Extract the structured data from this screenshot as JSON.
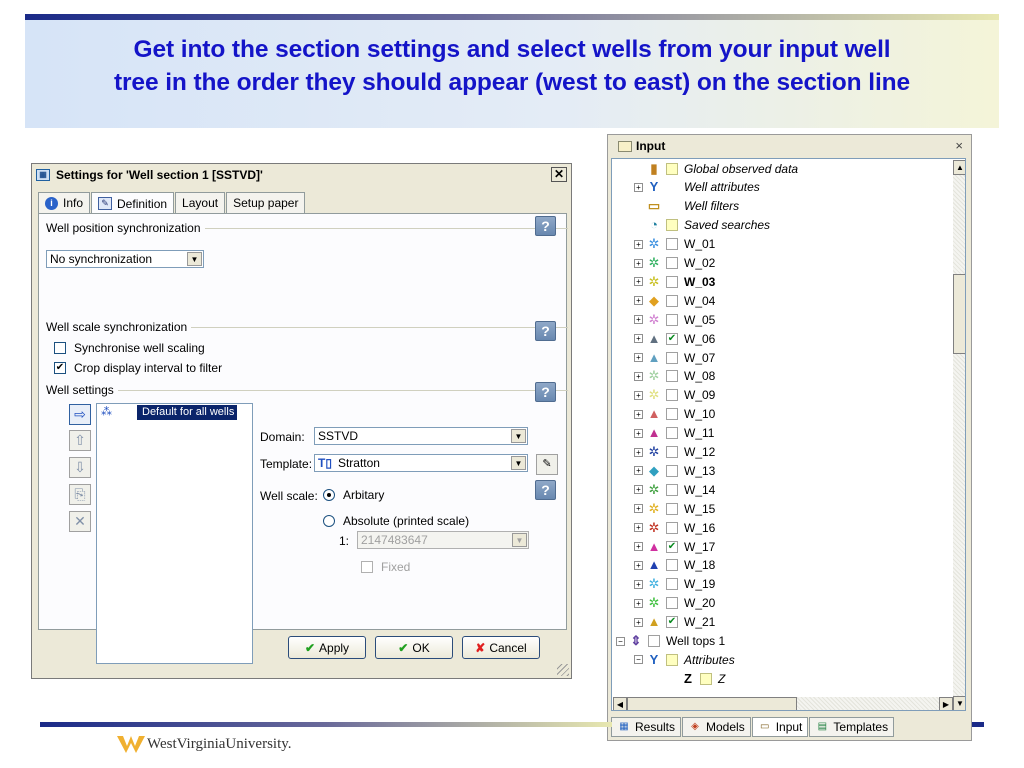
{
  "slide": {
    "title_line1": "Get into the section settings and select wells from your input well",
    "title_line2": "tree in the order they should appear (west to east) on the section line",
    "logo_text": "WestVirginiaUniversity."
  },
  "dialog": {
    "title": "Settings for 'Well section 1 [SSTVD]'",
    "close": "✕",
    "tabs": [
      "Info",
      "Definition",
      "Layout",
      "Setup paper"
    ],
    "active_tab": "Definition",
    "well_position_group": "Well position synchronization",
    "position_sync_value": "No synchronization",
    "scale_sync_group": "Well scale synchronization",
    "sync_scaling_label": "Synchronise well scaling",
    "sync_scaling_checked": false,
    "crop_label": "Crop display interval to filter",
    "crop_checked": true,
    "well_settings_group": "Well settings",
    "list_item": "Default for all wells",
    "domain_label": "Domain:",
    "domain_value": "SSTVD",
    "template_label": "Template:",
    "template_value": "Stratton",
    "well_scale_label": "Well scale:",
    "arbitrary_label": "Arbitary",
    "absolute_label": "Absolute (printed scale)",
    "scale_prefix": "1:",
    "scale_value": "2147483647",
    "fixed_label": "Fixed",
    "help": "?",
    "apply_label": "Apply",
    "ok_label": "OK",
    "cancel_label": "Cancel"
  },
  "tree": {
    "title": "Input",
    "close": "×",
    "items": [
      {
        "label": "Global observed data",
        "icon": "bar-chart-icon",
        "style": "it",
        "check": "yellow"
      },
      {
        "label": "Well attributes",
        "icon": "attributes-icon",
        "style": "it",
        "check": "none",
        "exp": "+"
      },
      {
        "label": "Well filters",
        "icon": "filter-icon",
        "style": "it",
        "check": "none"
      },
      {
        "label": "Saved searches",
        "icon": "search-folder-icon",
        "style": "it",
        "check": "yellow"
      },
      {
        "label": "W_01",
        "color": "#3a8fe0",
        "check": "off",
        "exp": "+"
      },
      {
        "label": "W_02",
        "color": "#30b060",
        "check": "off",
        "exp": "+"
      },
      {
        "label": "W_03",
        "color": "#c8c020",
        "check": "off",
        "exp": "+",
        "style": "b"
      },
      {
        "label": "W_04",
        "color": "#e0a020",
        "check": "off",
        "exp": "+",
        "shape": "diamond"
      },
      {
        "label": "W_05",
        "color": "#d080d0",
        "check": "off",
        "exp": "+"
      },
      {
        "label": "W_06",
        "color": "#607080",
        "check": "on",
        "exp": "+",
        "shape": "rig"
      },
      {
        "label": "W_07",
        "color": "#60a0c0",
        "check": "off",
        "exp": "+",
        "shape": "rig"
      },
      {
        "label": "W_08",
        "color": "#a0d0a0",
        "check": "off",
        "exp": "+"
      },
      {
        "label": "W_09",
        "color": "#e0e080",
        "check": "off",
        "exp": "+"
      },
      {
        "label": "W_10",
        "color": "#d06060",
        "check": "off",
        "exp": "+",
        "shape": "rig"
      },
      {
        "label": "W_11",
        "color": "#c03090",
        "check": "off",
        "exp": "+",
        "shape": "rig"
      },
      {
        "label": "W_12",
        "color": "#2040a0",
        "check": "off",
        "exp": "+"
      },
      {
        "label": "W_13",
        "color": "#30a0c0",
        "check": "off",
        "exp": "+",
        "shape": "diamond"
      },
      {
        "label": "W_14",
        "color": "#40a040",
        "check": "off",
        "exp": "+"
      },
      {
        "label": "W_15",
        "color": "#e0b020",
        "check": "off",
        "exp": "+"
      },
      {
        "label": "W_16",
        "color": "#c03020",
        "check": "off",
        "exp": "+"
      },
      {
        "label": "W_17",
        "color": "#d030a0",
        "check": "on",
        "exp": "+",
        "shape": "rig"
      },
      {
        "label": "W_18",
        "color": "#2040b0",
        "check": "off",
        "exp": "+",
        "shape": "rig"
      },
      {
        "label": "W_19",
        "color": "#40b0e0",
        "check": "off",
        "exp": "+"
      },
      {
        "label": "W_20",
        "color": "#40c040",
        "check": "off",
        "exp": "+"
      },
      {
        "label": "W_21",
        "color": "#d0a020",
        "check": "on",
        "exp": "+",
        "shape": "rig"
      },
      {
        "label": "Well tops 1",
        "icon": "well-tops-icon",
        "check": "off",
        "exp": "−",
        "level": 0
      },
      {
        "label": "Attributes",
        "icon": "attributes-icon",
        "style": "it",
        "check": "yellow",
        "exp": "−",
        "level": 1
      },
      {
        "label": "Z",
        "icon": "z-attribute-icon",
        "style": "it",
        "check": "yellow",
        "level": 2
      }
    ],
    "tabs": [
      "Results",
      "Models",
      "Input",
      "Templates"
    ],
    "active_tab": "Input"
  }
}
